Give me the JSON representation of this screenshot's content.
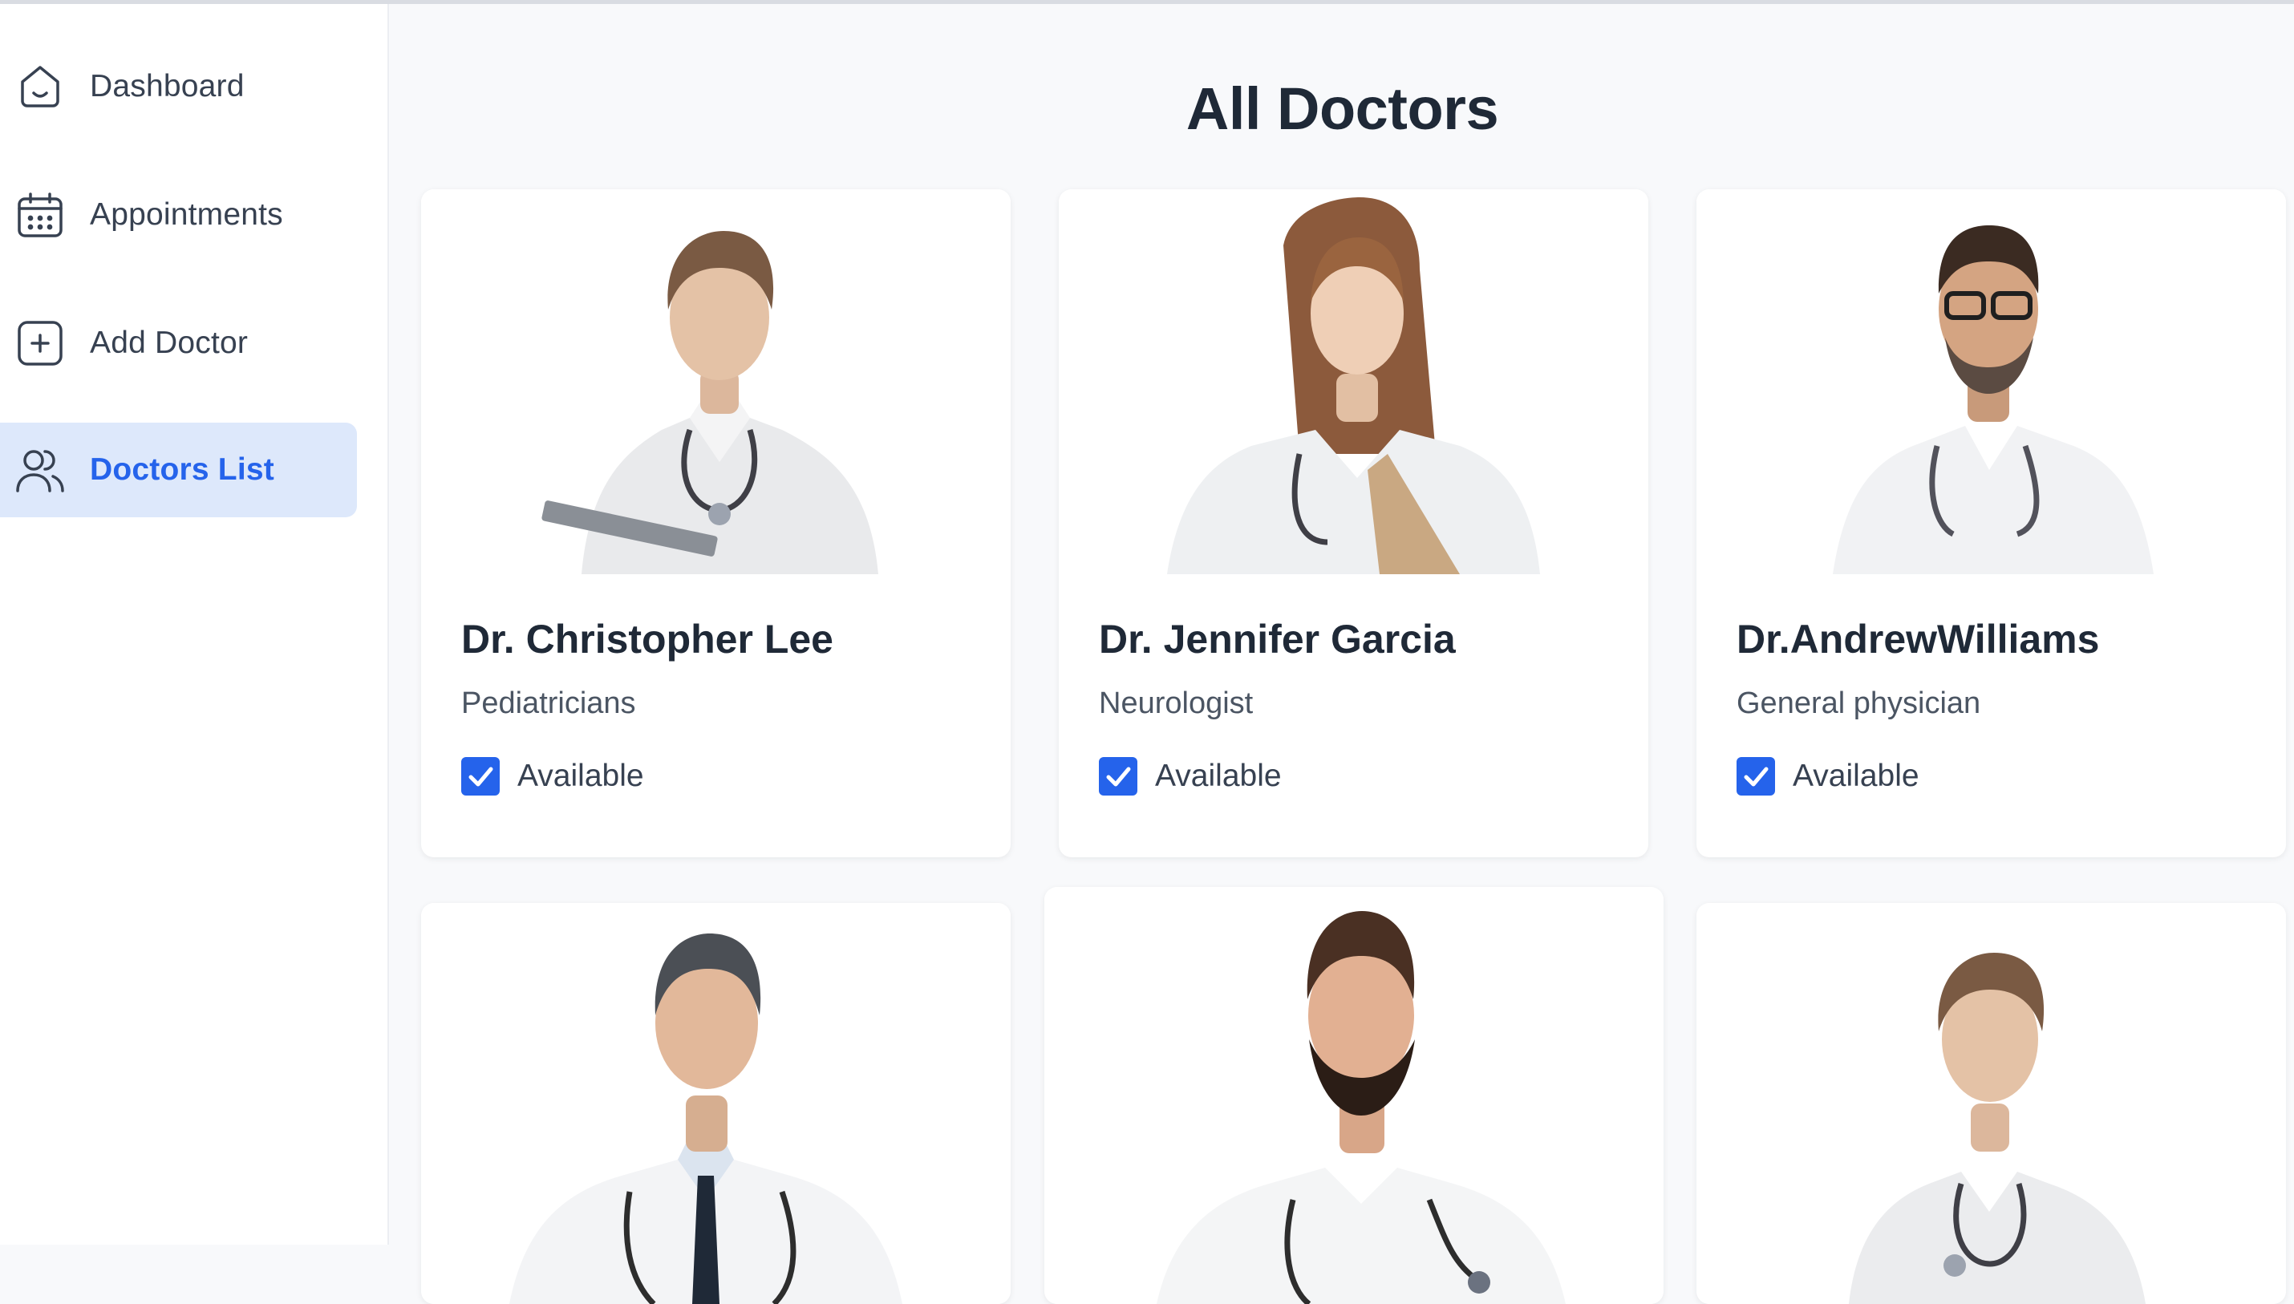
{
  "sidebar": {
    "items": [
      {
        "label": "Dashboard",
        "icon": "home-icon"
      },
      {
        "label": "Appointments",
        "icon": "calendar-icon"
      },
      {
        "label": "Add Doctor",
        "icon": "add-square-icon"
      },
      {
        "label": "Doctors List",
        "icon": "people-icon",
        "active": true
      }
    ]
  },
  "main": {
    "title": "All Doctors",
    "doctors": [
      {
        "name": "Dr. Christopher Lee",
        "speciality": "Pediatricians",
        "available_label": "Available",
        "available": true
      },
      {
        "name": "Dr. Jennifer Garcia",
        "speciality": "Neurologist",
        "available_label": "Available",
        "available": true
      },
      {
        "name": "Dr.AndrewWilliams",
        "speciality": "General physician",
        "available_label": "Available",
        "available": true
      },
      {},
      {},
      {}
    ]
  },
  "colors": {
    "accent": "#2563eb",
    "active_bg": "#dde8fb",
    "page_bg": "#f8f9fb",
    "card_bg": "#ffffff"
  }
}
